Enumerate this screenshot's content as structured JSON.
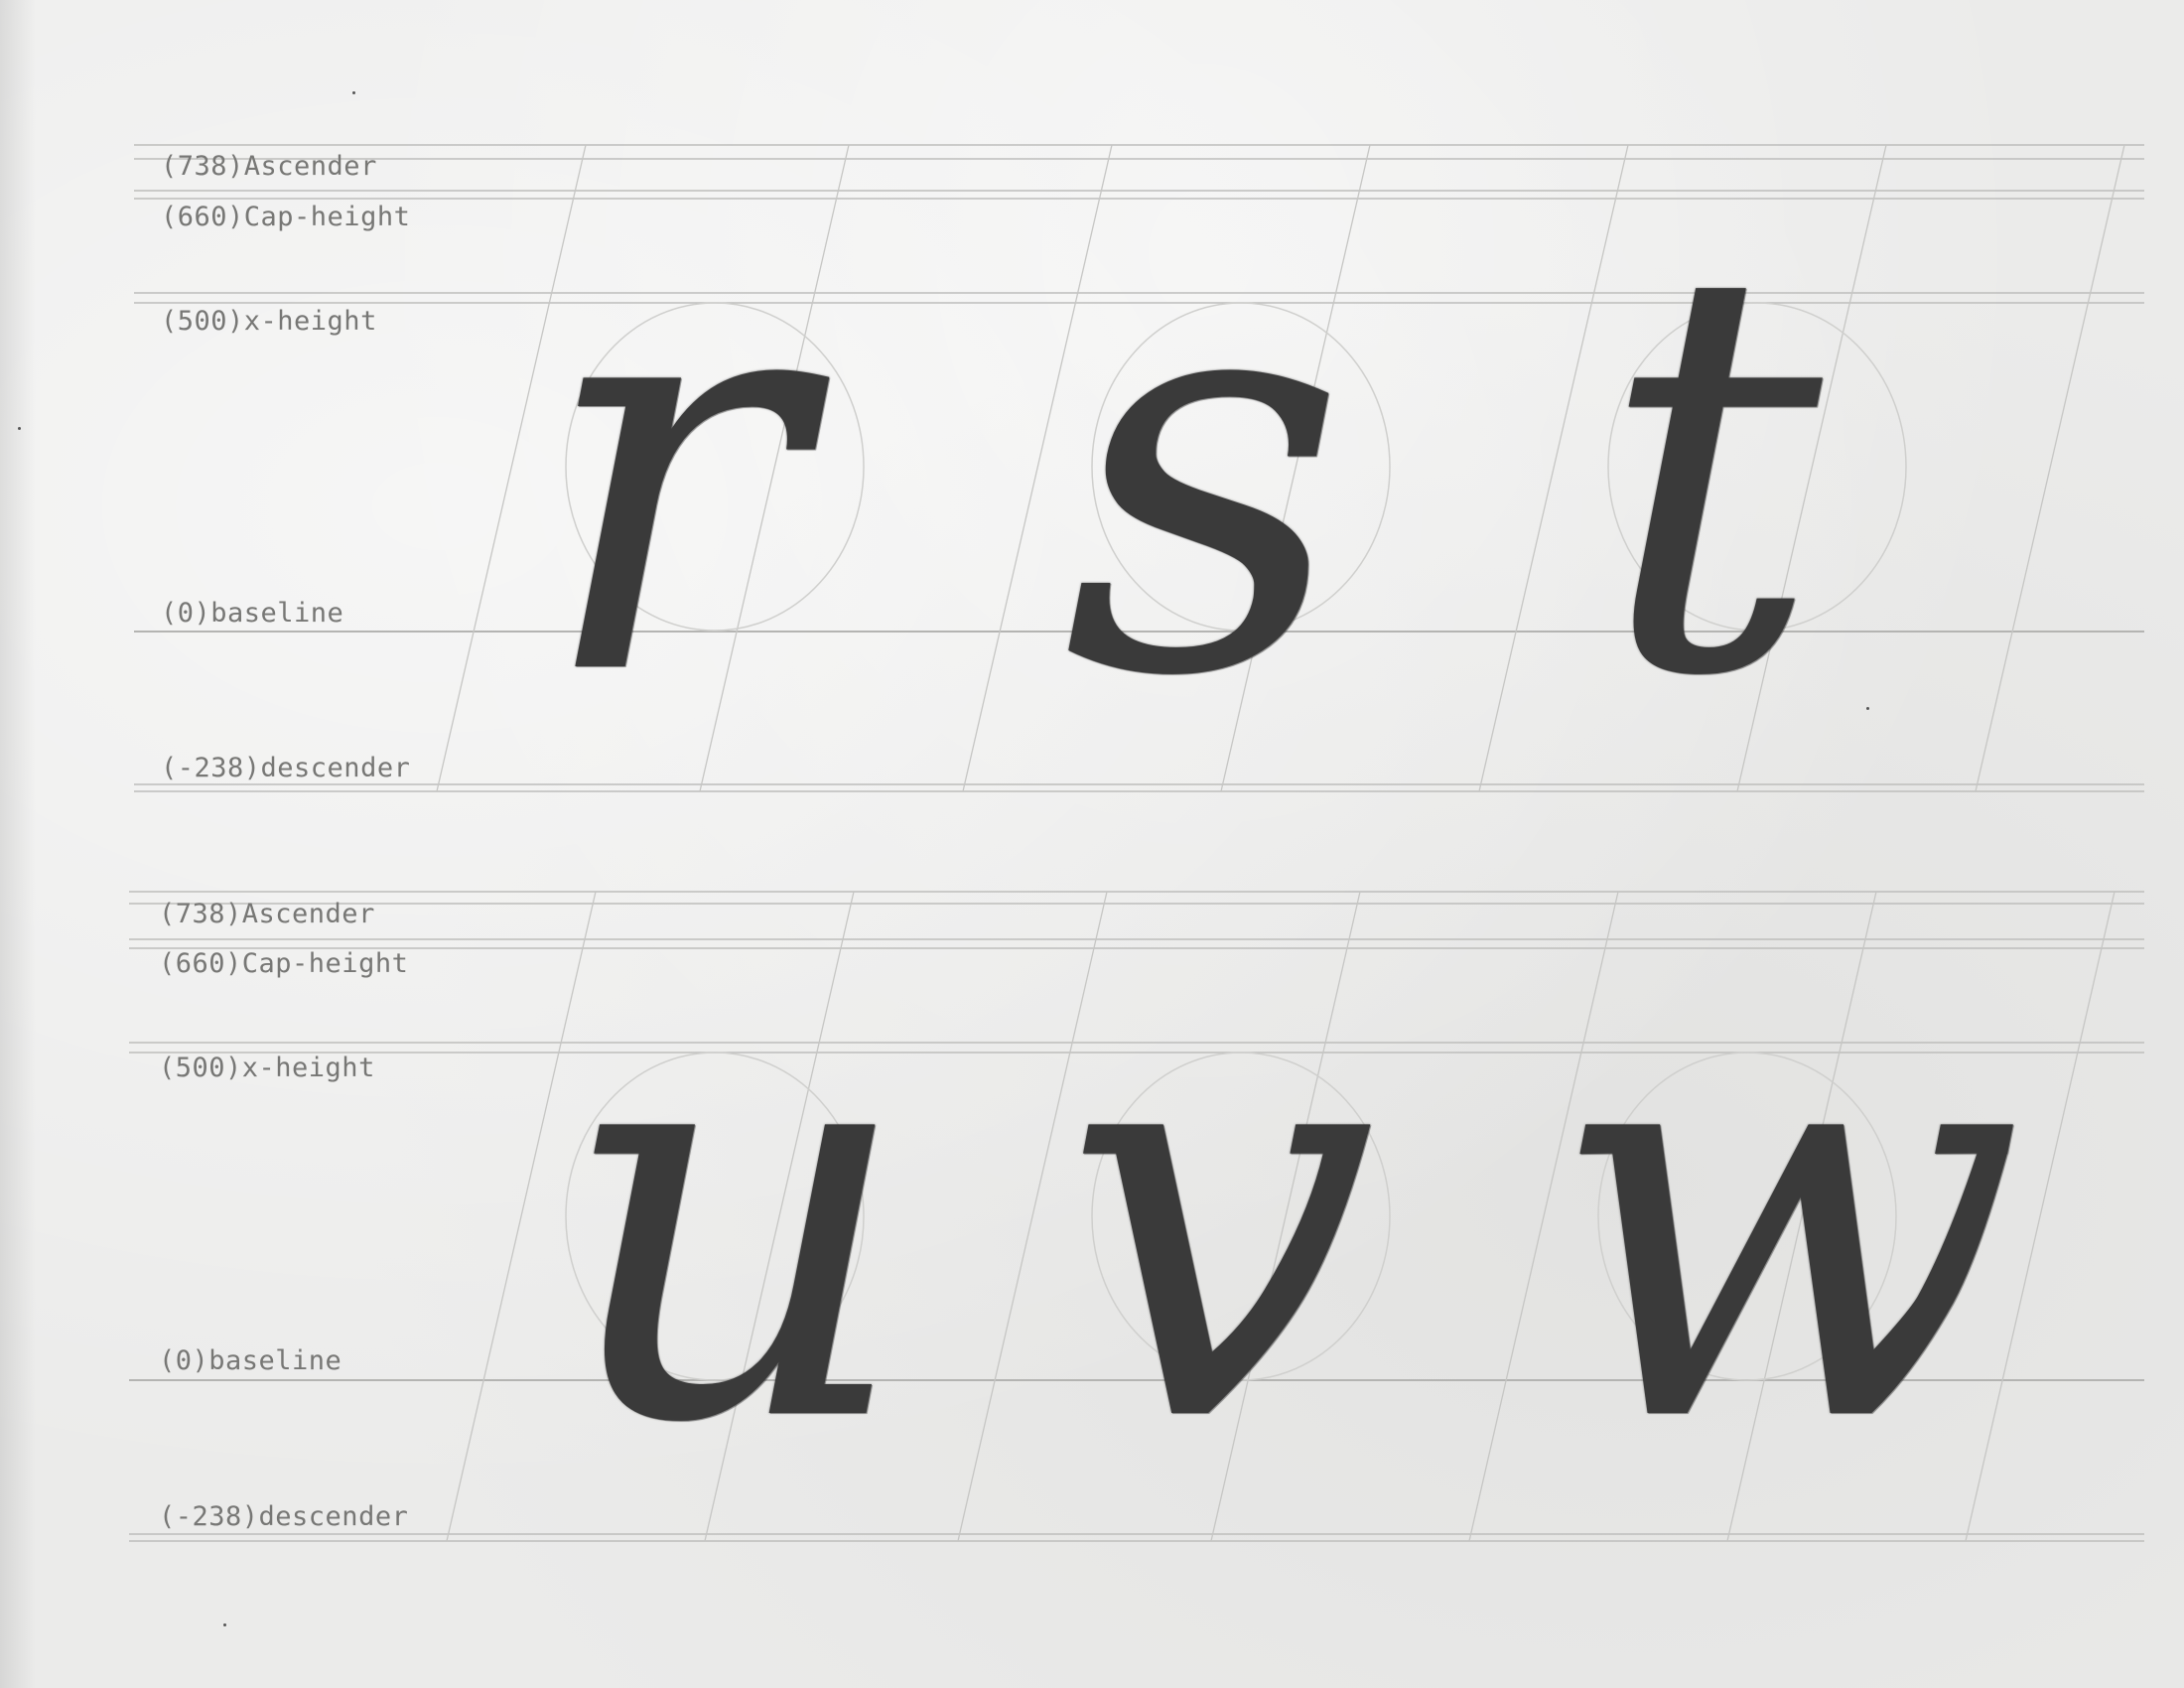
{
  "sheets": [
    {
      "labels": {
        "ascender": "(738)Ascender",
        "cap_height": "(660)Cap-height",
        "x_height": "(500)x-height",
        "baseline": "(0)baseline",
        "descender": "(-238)descender"
      },
      "glyphs": [
        "r",
        "s",
        "t"
      ]
    },
    {
      "labels": {
        "ascender": "(738)Ascender",
        "cap_height": "(660)Cap-height",
        "x_height": "(500)x-height",
        "baseline": "(0)baseline",
        "descender": "(-238)descender"
      },
      "glyphs": [
        "u",
        "v",
        "w"
      ]
    }
  ],
  "colors": {
    "paper": "#ebebea",
    "graphite": "#3a3a3a",
    "guide": "#bdbdbb",
    "label": "#777775"
  }
}
